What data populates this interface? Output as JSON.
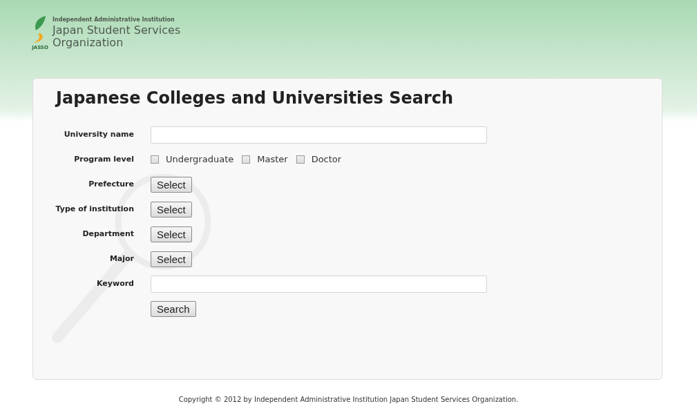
{
  "header": {
    "logo_mark": "JASSO",
    "org_subtitle": "Independent Administrative Institution",
    "org_name_line_1": "Japan Student Services",
    "org_name_line_2": "Organization"
  },
  "title": "Japanese Colleges and Universities Search",
  "form_rows": [
    {
      "kind": "text",
      "label": "University name"
    },
    {
      "kind": "checkboxes",
      "label": "Program level",
      "options": [
        {
          "label": "Undergraduate",
          "checked": false
        },
        {
          "label": "Master",
          "checked": false
        },
        {
          "label": "Doctor",
          "checked": false
        }
      ]
    },
    {
      "kind": "select",
      "label": "Prefecture",
      "button": "Select"
    },
    {
      "kind": "select",
      "label": "Type of institution",
      "button": "Select"
    },
    {
      "kind": "select",
      "label": "Department",
      "button": "Select"
    },
    {
      "kind": "select",
      "label": "Major",
      "button": "Select"
    },
    {
      "kind": "text",
      "label": "Keyword"
    }
  ],
  "search_button": "Search",
  "footer": "Copyright © 2012 by Independent Administrative Institution Japan Student Services Organization."
}
